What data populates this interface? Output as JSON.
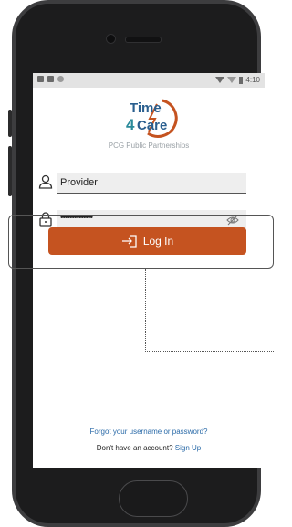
{
  "status_bar": {
    "time": "4:10"
  },
  "logo": {
    "line1": "Time",
    "line2": "4",
    "line3": "Care",
    "tagline": "PCG Public Partnerships"
  },
  "username": {
    "value": "Provider"
  },
  "password": {
    "value": "••••••••••••••"
  },
  "login_button": {
    "label": "Log In"
  },
  "forgot_link": "Forgot your username or password?",
  "signup": {
    "prompt": "Don't have an account?",
    "link": "Sign Up"
  },
  "colors": {
    "brand_orange": "#c55320",
    "brand_teal": "#2a8a9a",
    "link_blue": "#2a6aa8"
  }
}
